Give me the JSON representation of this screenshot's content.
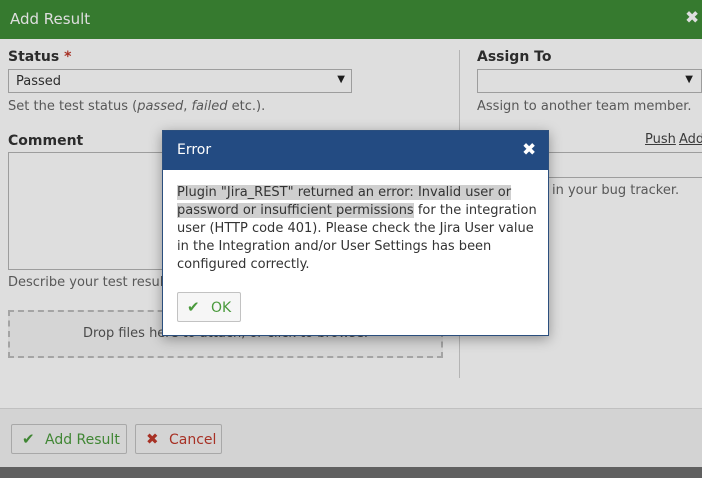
{
  "dialog": {
    "title": "Add Result",
    "close_glyph": "✖",
    "status": {
      "label": "Status",
      "required_mark": "*",
      "selected": "Passed",
      "hint_prefix": "Set the test status (",
      "hint_passed": "passed",
      "hint_sep": ", ",
      "hint_failed": "failed",
      "hint_suffix": " etc.)."
    },
    "assign_to": {
      "label": "Assign To",
      "selected": "",
      "hint": "Assign to another team member."
    },
    "comment": {
      "label": "Comment",
      "value": "",
      "hint": "Describe your test result."
    },
    "defects": {
      "push_link": "Push",
      "add_link": "Add",
      "hint": "in your bug tracker."
    },
    "drop_zone": "Drop files here to attach, or click to browse.",
    "footer": {
      "add_result_label": "Add Result",
      "cancel_label": "Cancel"
    }
  },
  "error_modal": {
    "title": "Error",
    "close_glyph": "✖",
    "message_highlight": "Plugin \"Jira_REST\" returned an error: Invalid user or password or insufficient permissions",
    "message_rest": " for the integration user (HTTP code 401). Please check the Jira User value in the Integration and/or User Settings has been configured correctly.",
    "ok_label": "OK"
  },
  "icons": {
    "check": "check-icon",
    "cross": "cross-icon",
    "close": "close-icon",
    "dropdown": "chevron-down-icon"
  },
  "colors": {
    "titlebar": "#3e8d36",
    "modal_header": "#234b82",
    "ok_green": "#4a9a3c",
    "cancel_red": "#c0392b",
    "highlight": "#cfcfcf"
  }
}
